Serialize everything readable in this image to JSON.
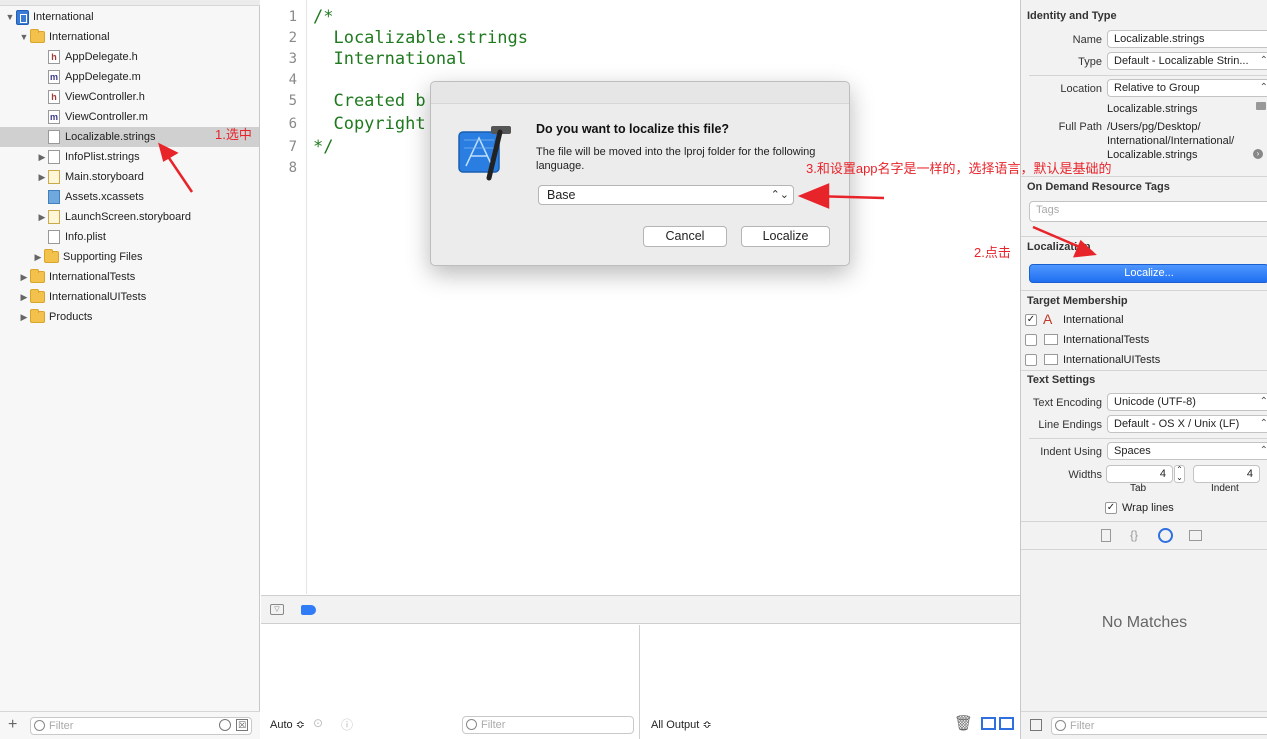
{
  "navigator": {
    "items": [
      {
        "label": "International",
        "icon": "project-icon",
        "level": 0,
        "expanded": true
      },
      {
        "label": "International",
        "icon": "folder-icon",
        "level": 1,
        "expanded": true
      },
      {
        "label": "AppDelegate.h",
        "icon": "header-file-icon",
        "badge": "h",
        "level": 2
      },
      {
        "label": "AppDelegate.m",
        "icon": "source-file-icon",
        "badge": "m",
        "level": 2
      },
      {
        "label": "ViewController.h",
        "icon": "header-file-icon",
        "badge": "h",
        "level": 2
      },
      {
        "label": "ViewController.m",
        "icon": "source-file-icon",
        "badge": "m",
        "level": 2
      },
      {
        "label": "Localizable.strings",
        "icon": "strings-file-icon",
        "level": 2,
        "selected": true
      },
      {
        "label": "InfoPlist.strings",
        "icon": "strings-file-icon",
        "level": 2,
        "collapsed": true
      },
      {
        "label": "Main.storyboard",
        "icon": "storyboard-file-icon",
        "level": 2,
        "collapsed": true
      },
      {
        "label": "Assets.xcassets",
        "icon": "asset-catalog-icon",
        "level": 2
      },
      {
        "label": "LaunchScreen.storyboard",
        "icon": "storyboard-file-icon",
        "level": 2,
        "collapsed": true
      },
      {
        "label": "Info.plist",
        "icon": "plist-file-icon",
        "level": 2
      },
      {
        "label": "Supporting Files",
        "icon": "folder-icon",
        "level": 2,
        "collapsed": true
      },
      {
        "label": "InternationalTests",
        "icon": "folder-icon",
        "level": 1,
        "collapsed": true
      },
      {
        "label": "InternationalUITests",
        "icon": "folder-icon",
        "level": 1,
        "collapsed": true
      },
      {
        "label": "Products",
        "icon": "folder-icon",
        "level": 1,
        "collapsed": true
      }
    ],
    "filter_placeholder": "Filter"
  },
  "editor": {
    "line_numbers": [
      "1",
      "2",
      "3",
      "4",
      "5",
      "6",
      "7",
      "8"
    ],
    "lines": [
      "/*",
      "  Localizable.strings",
      "  International",
      "",
      "  Created b",
      "  Copyright",
      "*/",
      ""
    ]
  },
  "debug": {
    "auto_label": "Auto ≎",
    "left_filter_placeholder": "Filter",
    "output_label": "All Output ≎",
    "right_filter_placeholder": "Filter"
  },
  "inspector": {
    "identity_title": "Identity and Type",
    "name_label": "Name",
    "name_value": "Localizable.strings",
    "type_label": "Type",
    "type_value": "Default - Localizable Strin...",
    "location_label": "Location",
    "location_value": "Relative to Group",
    "location_file": "Localizable.strings",
    "fullpath_label": "Full Path",
    "fullpath_lines": [
      "/Users/pg/Desktop/",
      "International/International/",
      "Localizable.strings"
    ],
    "odr_title": "On Demand Resource Tags",
    "tags_placeholder": "Tags",
    "localization_title": "Localization",
    "localize_button": "Localize...",
    "target_title": "Target Membership",
    "targets": [
      {
        "label": "International",
        "checked": true
      },
      {
        "label": "InternationalTests",
        "checked": false
      },
      {
        "label": "InternationalUITests",
        "checked": false
      }
    ],
    "text_settings_title": "Text Settings",
    "encoding_label": "Text Encoding",
    "encoding_value": "Unicode (UTF-8)",
    "line_endings_label": "Line Endings",
    "line_endings_value": "Default - OS X / Unix (LF)",
    "indent_label": "Indent Using",
    "indent_value": "Spaces",
    "widths_label": "Widths",
    "tab_value": "4",
    "indent_width_value": "4",
    "tab_caption": "Tab",
    "indent_caption": "Indent",
    "wrap_label": "Wrap lines",
    "wrap_checked": true,
    "no_matches": "No Matches",
    "filter_placeholder": "Filter"
  },
  "dialog": {
    "title": "Do you want to localize this file?",
    "message": "The file will be moved into the lproj folder for the following language.",
    "selected_language": "Base",
    "cancel_label": "Cancel",
    "localize_label": "Localize"
  },
  "annotations": {
    "step1": "1.选中",
    "step2": "2.点击",
    "step3": "3.和设置app名字是一样的，选择语言，默认是基础的"
  },
  "colors": {
    "annotation": "#e8242b",
    "accent_blue": "#1f6ff0",
    "code_green": "#1f7a1f"
  }
}
